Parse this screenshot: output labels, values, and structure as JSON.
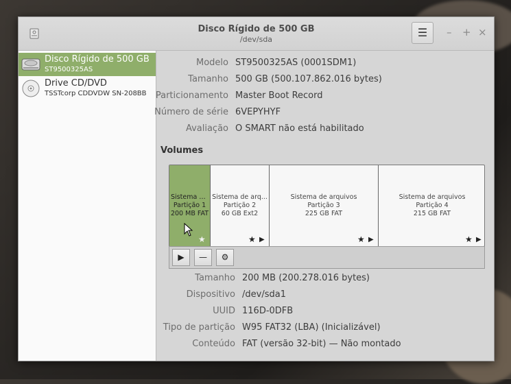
{
  "window": {
    "title": "Disco Rígido de 500 GB",
    "subtitle": "/dev/sda",
    "menu_icon": "hamburger-icon",
    "controls": [
      "–",
      "+",
      "×"
    ]
  },
  "sidebar": {
    "items": [
      {
        "name": "Disco Rígido de 500 GB",
        "sub": "ST9500325AS",
        "selected": true,
        "icon": "hard-disk-icon"
      },
      {
        "name": "Drive CD/DVD",
        "sub": "TSSTcorp CDDVDW SN-208BB",
        "selected": false,
        "icon": "optical-disc-icon"
      }
    ]
  },
  "drive_props": [
    {
      "label": "Modelo",
      "value": "ST9500325AS (0001SDM1)"
    },
    {
      "label": "Tamanho",
      "value": "500 GB (500.107.862.016 bytes)"
    },
    {
      "label": "Particionamento",
      "value": "Master Boot Record"
    },
    {
      "label": "Número de série",
      "value": "6VEPYHYF"
    },
    {
      "label": "Avaliação",
      "value": "O SMART não está habilitado"
    }
  ],
  "volumes": {
    "heading": "Volumes",
    "partitions": [
      {
        "line1": "Sistema d...",
        "line2": "Partição 1",
        "line3": "200 MB FAT",
        "selected": true
      },
      {
        "line1": "Sistema de arq...",
        "line2": "Partição 2",
        "line3": "60 GB Ext2",
        "selected": false
      },
      {
        "line1": "Sistema de arquivos",
        "line2": "Partição 3",
        "line3": "225 GB FAT",
        "selected": false
      },
      {
        "line1": "Sistema de arquivos",
        "line2": "Partição 4",
        "line3": "215 GB FAT",
        "selected": false
      }
    ],
    "toolbar": {
      "play": "▶",
      "minus": "—",
      "gear": "⚙"
    }
  },
  "volume_props": [
    {
      "label": "Tamanho",
      "value": "200 MB (200.278.016 bytes)"
    },
    {
      "label": "Dispositivo",
      "value": "/dev/sda1"
    },
    {
      "label": "UUID",
      "value": "116D-0DFB"
    },
    {
      "label": "Tipo de partição",
      "value": "W95 FAT32 (LBA) (Inicializável)"
    },
    {
      "label": "Conteúdo",
      "value": "FAT (versão 32-bit) — Não montado"
    }
  ],
  "colors": {
    "selection": "#8fae6a",
    "window_bg": "#d6d6d6"
  }
}
